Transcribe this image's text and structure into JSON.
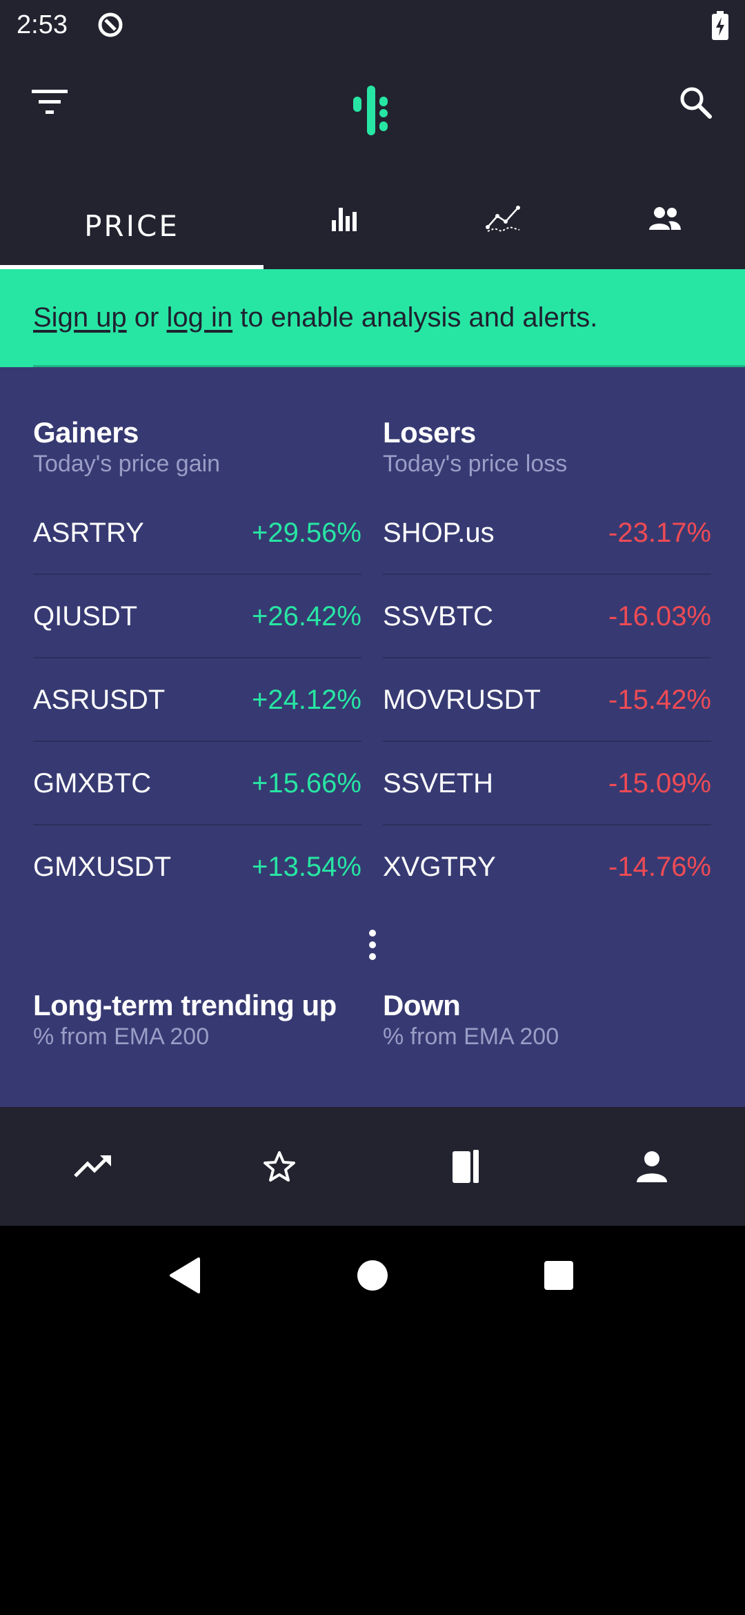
{
  "status_bar": {
    "time": "2:53"
  },
  "tabs": [
    {
      "label": "PRICE",
      "icon": "",
      "selected": true
    },
    {
      "label": "",
      "icon": "bar-chart-icon",
      "selected": false
    },
    {
      "label": "",
      "icon": "line-chart-icon",
      "selected": false
    },
    {
      "label": "",
      "icon": "people-icon",
      "selected": false
    }
  ],
  "banner": {
    "signup_link": "Sign up",
    "or_text": " or ",
    "login_link": "log in",
    "rest_text": " to enable analysis and alerts."
  },
  "gainers": {
    "title": "Gainers",
    "subtitle": "Today's price gain",
    "items": [
      {
        "symbol": "ASRTRY",
        "change": "+29.56%"
      },
      {
        "symbol": "QIUSDT",
        "change": "+26.42%"
      },
      {
        "symbol": "ASRUSDT",
        "change": "+24.12%"
      },
      {
        "symbol": "GMXBTC",
        "change": "+15.66%"
      },
      {
        "symbol": "GMXUSDT",
        "change": "+13.54%"
      }
    ]
  },
  "losers": {
    "title": "Losers",
    "subtitle": "Today's price loss",
    "items": [
      {
        "symbol": "SHOP.us",
        "change": "-23.17%"
      },
      {
        "symbol": "SSVBTC",
        "change": "-16.03%"
      },
      {
        "symbol": "MOVRUSDT",
        "change": "-15.42%"
      },
      {
        "symbol": "SSVETH",
        "change": "-15.09%"
      },
      {
        "symbol": "XVGTRY",
        "change": "-14.76%"
      }
    ]
  },
  "trending_up": {
    "title": "Long-term trending up",
    "subtitle": "% from EMA 200"
  },
  "trending_down": {
    "title": "Down",
    "subtitle": "% from EMA 200"
  },
  "bottom_nav": [
    {
      "icon": "trending-up-icon"
    },
    {
      "icon": "star-icon"
    },
    {
      "icon": "book-icon"
    },
    {
      "icon": "person-icon"
    }
  ],
  "colors": {
    "accent": "#27e6a3",
    "gain": "#27e6a3",
    "loss": "#ef4b55",
    "app_bar": "#22232f",
    "content_bg": "#373a72"
  }
}
